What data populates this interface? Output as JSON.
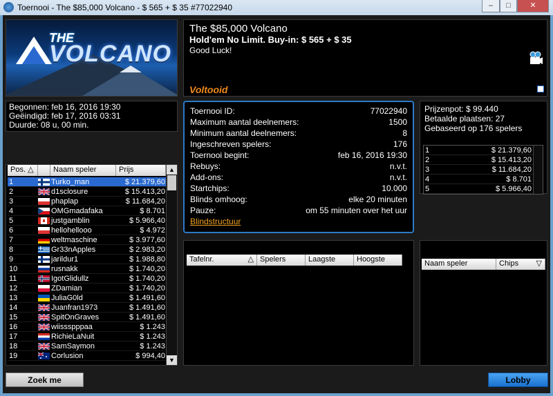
{
  "window": {
    "title": "Toernooi - The $85,000 Volcano - $ 565 + $ 35 #77022940"
  },
  "banner": {
    "logo_the": "THE",
    "logo_volcano": "VOLCANO"
  },
  "info": {
    "name": "The $85,000 Volcano",
    "game": "Hold'em No Limit. Buy-in: $ 565 + $ 35",
    "message": "Good Luck!",
    "status": "Voltooid"
  },
  "dates": {
    "started": "Begonnen: feb 16, 2016 19:30",
    "ended": "Geëindigd: feb 17, 2016 03:31",
    "duration": "Duurde: 08 u, 00 min."
  },
  "tournament": {
    "rows": [
      {
        "label": "Toernooi ID:",
        "value": "77022940"
      },
      {
        "label": "Maximum aantal deelnemers:",
        "value": "1500"
      },
      {
        "label": "Minimum aantal deelnemers:",
        "value": "8"
      },
      {
        "label": "Ingeschreven spelers:",
        "value": "176"
      },
      {
        "label": "Toernooi begint:",
        "value": "feb 16, 2016 19:30"
      },
      {
        "label": "Rebuys:",
        "value": "n.v.t."
      },
      {
        "label": "Add-ons:",
        "value": "n.v.t."
      },
      {
        "label": "Startchips:",
        "value": "10.000"
      },
      {
        "label": "Blinds omhoog:",
        "value": "elke 20 minuten"
      },
      {
        "label": "Pauze:",
        "value": "om 55 minuten over het uur"
      }
    ],
    "blind_link": "Blindstructuur"
  },
  "prize": {
    "pot": "Prijzenpot: $ 99.440",
    "paid": "Betaalde plaatsen: 27",
    "based": "Gebaseerd op 176 spelers",
    "places": [
      {
        "pos": "1",
        "amount": "$ 21.379,60"
      },
      {
        "pos": "2",
        "amount": "$ 15.413,20"
      },
      {
        "pos": "3",
        "amount": "$ 11.684,20"
      },
      {
        "pos": "4",
        "amount": "$ 8.701"
      },
      {
        "pos": "5",
        "amount": "$ 5.966,40"
      }
    ]
  },
  "players": {
    "headers": {
      "pos": "Pos.",
      "name": "Naam speler",
      "prize": "Prijs"
    },
    "rows": [
      {
        "pos": "1",
        "flag": "fi",
        "name": "Turko_man",
        "prize": "$ 21.379,60"
      },
      {
        "pos": "2",
        "flag": "gb",
        "name": "d1sclosure",
        "prize": "$ 15.413,20"
      },
      {
        "pos": "3",
        "flag": "un",
        "name": "phaplap",
        "prize": "$ 11.684,20"
      },
      {
        "pos": "4",
        "flag": "cz",
        "name": "OMGmadafaka",
        "prize": "$ 8.701"
      },
      {
        "pos": "5",
        "flag": "ca",
        "name": "justgamblin",
        "prize": "$ 5.966,40"
      },
      {
        "pos": "6",
        "flag": "un",
        "name": "hellohellooo",
        "prize": "$ 4.972"
      },
      {
        "pos": "7",
        "flag": "de",
        "name": "weltmaschine",
        "prize": "$ 3.977,60"
      },
      {
        "pos": "8",
        "flag": "gr",
        "name": "Gr33nApples",
        "prize": "$ 2.983,20"
      },
      {
        "pos": "9",
        "flag": "fi",
        "name": "jarildur1",
        "prize": "$ 1.988,80"
      },
      {
        "pos": "10",
        "flag": "ru",
        "name": "rusnakk",
        "prize": "$ 1.740,20"
      },
      {
        "pos": "11",
        "flag": "no",
        "name": "IgotGlidullz",
        "prize": "$ 1.740,20"
      },
      {
        "pos": "12",
        "flag": "pl",
        "name": "ZDamian",
        "prize": "$ 1.740,20"
      },
      {
        "pos": "13",
        "flag": "ua",
        "name": "JuliaG0ld",
        "prize": "$ 1.491,60"
      },
      {
        "pos": "14",
        "flag": "gb",
        "name": "Juanfran1973",
        "prize": "$ 1.491,60"
      },
      {
        "pos": "15",
        "flag": "gb",
        "name": "SpitOnGraves",
        "prize": "$ 1.491,60"
      },
      {
        "pos": "16",
        "flag": "gb",
        "name": "wiissspppaa",
        "prize": "$ 1.243"
      },
      {
        "pos": "17",
        "flag": "py",
        "name": "RichieLaNuit",
        "prize": "$ 1.243"
      },
      {
        "pos": "18",
        "flag": "gb",
        "name": "SamSaymon",
        "prize": "$ 1.243"
      },
      {
        "pos": "19",
        "flag": "au",
        "name": "Corlusion",
        "prize": "$ 994,40"
      }
    ]
  },
  "tables": {
    "headers": {
      "table": "Tafelnr.",
      "players": "Spelers",
      "low": "Laagste",
      "high": "Hoogste"
    }
  },
  "chips_panel": {
    "headers": {
      "name": "Naam speler",
      "chips": "Chips"
    }
  },
  "buttons": {
    "search": "Zoek me",
    "lobby": "Lobby"
  }
}
